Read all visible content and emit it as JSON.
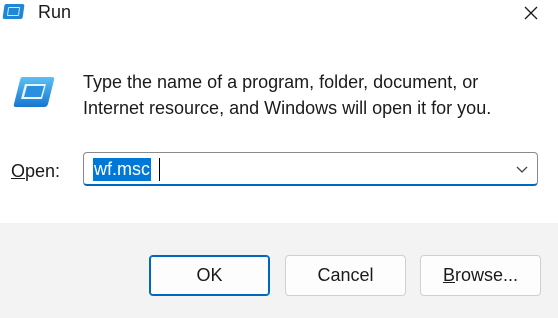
{
  "window": {
    "title": "Run",
    "title_icon": "run-icon",
    "close_icon": "close-icon"
  },
  "main": {
    "icon": "run-icon",
    "description": "Type the name of a program, folder, document, or Internet resource, and Windows will open it for you.",
    "open_label_accel": "O",
    "open_label_rest": "pen:",
    "open_value": "wf.msc",
    "dropdown_icon": "chevron-down-icon"
  },
  "buttons": {
    "ok": "OK",
    "cancel": "Cancel",
    "browse_accel": "B",
    "browse_rest": "rowse..."
  },
  "colors": {
    "accent": "#0067c0",
    "selection": "#0078d7",
    "footer_bg": "#f3f3f3"
  }
}
